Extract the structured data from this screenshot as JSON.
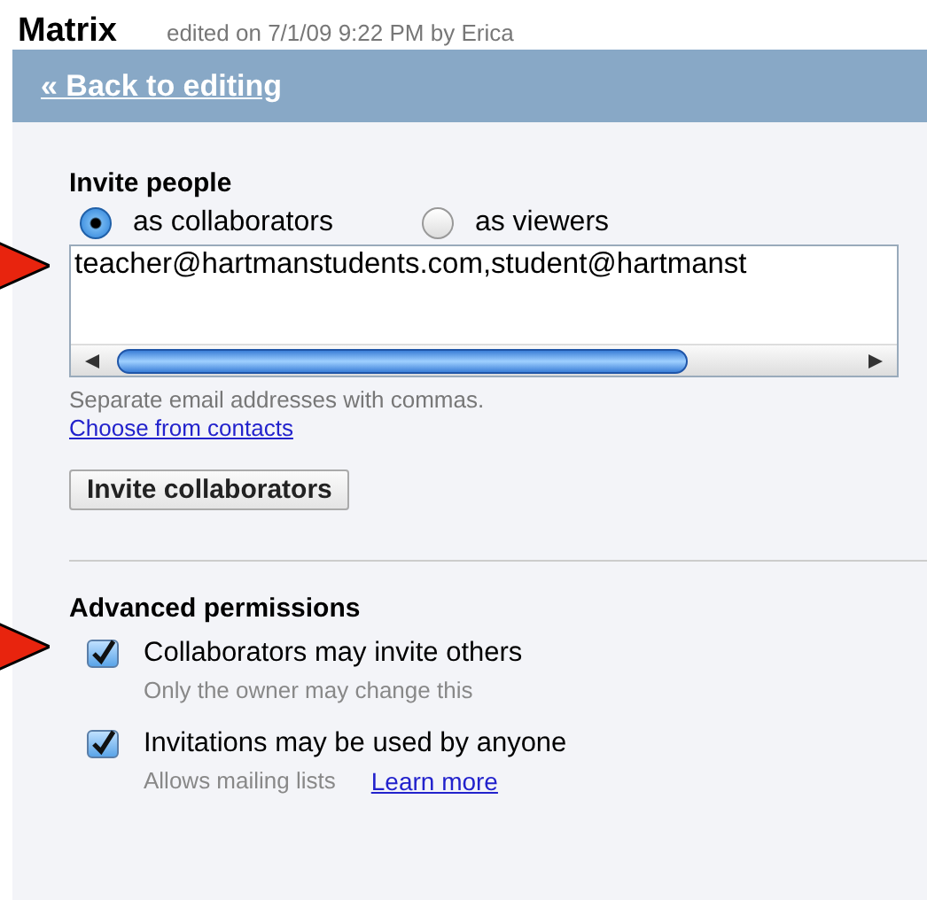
{
  "header": {
    "title": "Matrix",
    "edited": "edited on 7/1/09 9:22 PM by Erica"
  },
  "back_link": "« Back to editing",
  "invite": {
    "heading": "Invite people",
    "roles": [
      {
        "label": "as collaborators",
        "selected": true
      },
      {
        "label": "as viewers",
        "selected": false
      }
    ],
    "emails": "teacher@hartmanstudents.com,student@hartmanst",
    "hint": "Separate email addresses with commas.",
    "contacts_link": "Choose from contacts",
    "button": "Invite collaborators"
  },
  "advanced": {
    "heading": "Advanced permissions",
    "options": [
      {
        "label": "Collaborators may invite others",
        "checked": true,
        "note": "Only the owner may change this"
      },
      {
        "label": "Invitations may be used by anyone",
        "checked": true,
        "note": "Allows mailing lists",
        "link": "Learn more"
      }
    ]
  }
}
